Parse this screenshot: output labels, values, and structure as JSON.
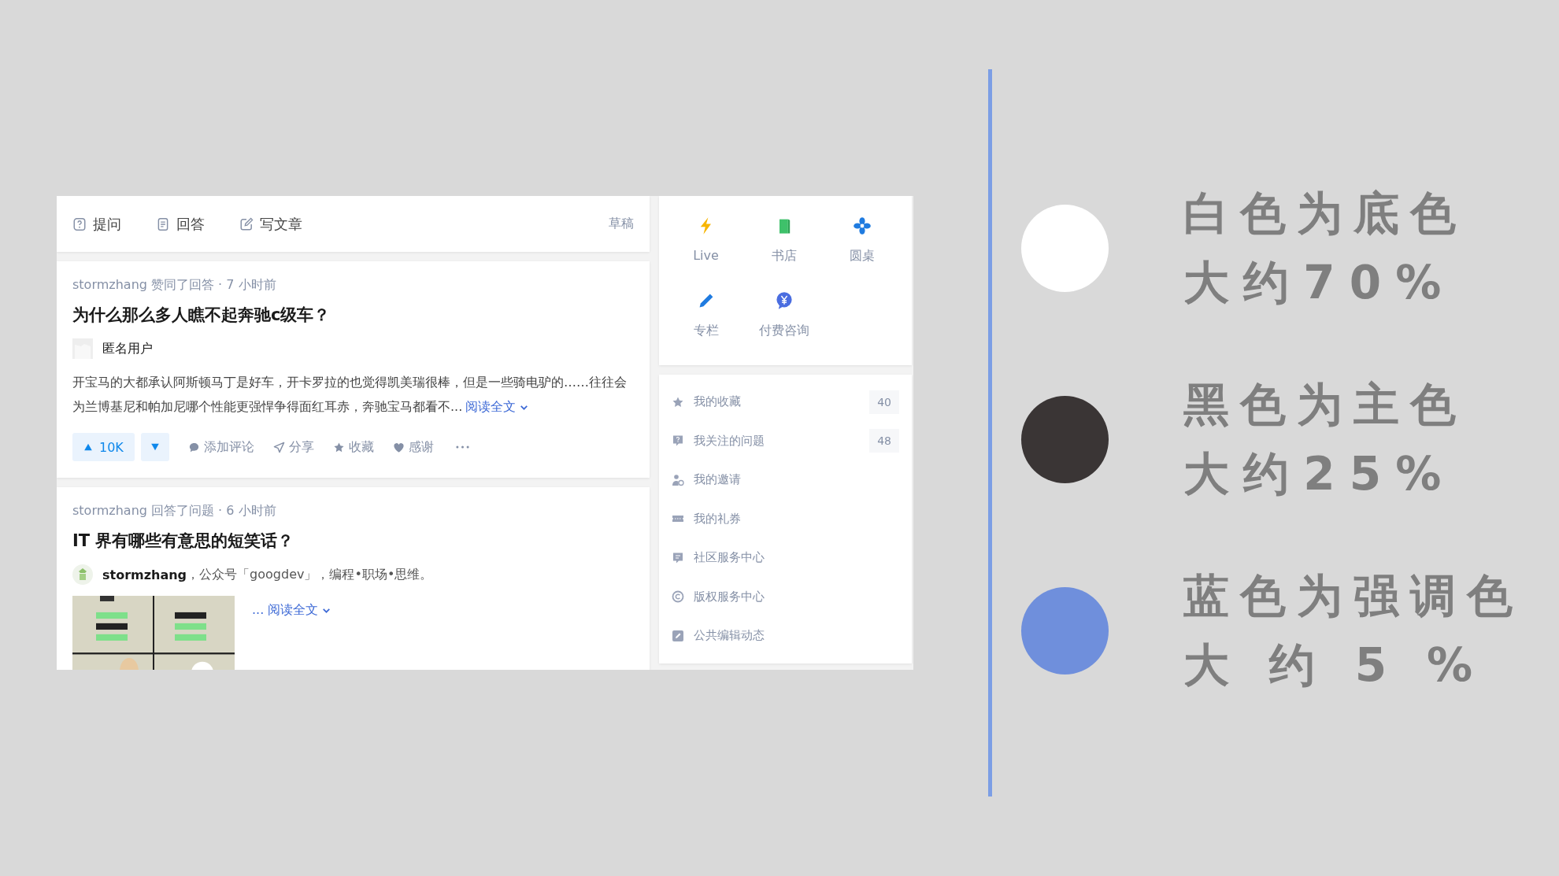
{
  "screenshot": {
    "compose_bar": {
      "actions": [
        {
          "label": "提问"
        },
        {
          "label": "回答"
        },
        {
          "label": "写文章"
        }
      ],
      "drafts": "草稿"
    },
    "feed": [
      {
        "kind": "text",
        "meta": "stormzhang 赞同了回答 · 7 小时前",
        "title": "为什么那么多人瞧不起奔驰c级车？",
        "author": {
          "name": "匿名用户"
        },
        "excerpt": "开宝马的大都承认阿斯顿马丁是好车，开卡罗拉的也觉得凯美瑞很棒，但是一些骑电驴的……往往会为兰博基尼和帕加尼哪个性能更强悍争得面红耳赤，奔驰宝马都看不...",
        "read_more": "阅读全文",
        "upvotes": "10K",
        "actions": [
          "添加评论",
          "分享",
          "收藏",
          "感谢"
        ]
      },
      {
        "meta": "stormzhang 回答了问题 · 6 小时前",
        "title": "IT 界有哪些有意思的短笑话？",
        "author": {
          "name": "stormzhang",
          "bio": "，公众号「googdev」，编程•职场•思维。"
        },
        "read_more": "... 阅读全文"
      }
    ],
    "shortcuts": [
      {
        "label": "Live"
      },
      {
        "label": "书店"
      },
      {
        "label": "圆桌"
      },
      {
        "label": "专栏"
      },
      {
        "label": "付费咨询"
      }
    ],
    "menu": [
      {
        "label": "我的收藏",
        "count": "40"
      },
      {
        "label": "我关注的问题",
        "count": "48"
      },
      {
        "label": "我的邀请"
      },
      {
        "label": "我的礼券"
      },
      {
        "label": "社区服务中心"
      },
      {
        "label": "版权服务中心"
      },
      {
        "label": "公共编辑动态"
      }
    ]
  },
  "palette": [
    {
      "color": "#ffffff",
      "heading": "白色为底色",
      "share": "大约70%"
    },
    {
      "color": "#3a3535",
      "heading": "黑色为主色",
      "share": "大约25%"
    },
    {
      "color": "#6f8fdc",
      "heading": "蓝色为强调色",
      "share": "大约5%"
    }
  ]
}
